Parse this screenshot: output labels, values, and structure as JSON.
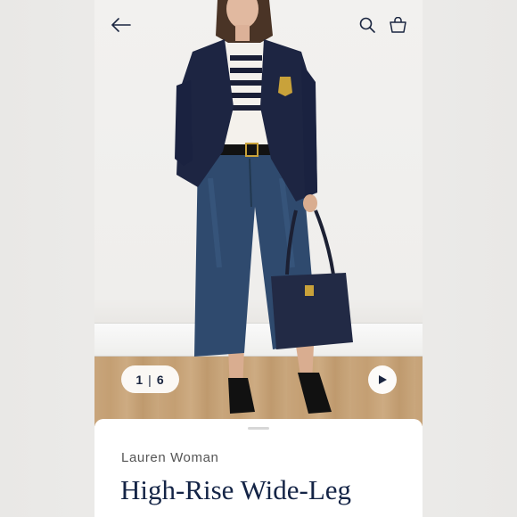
{
  "nav": {
    "back_icon": "arrow-left-icon",
    "search_icon": "search-icon",
    "bag_icon": "shopping-bag-icon"
  },
  "gallery": {
    "current": "1",
    "separator": "|",
    "total": "6",
    "play_icon": "play-icon"
  },
  "product": {
    "brand": "Lauren Woman",
    "title": "High-Rise Wide-Leg"
  },
  "colors": {
    "navy": "#142446",
    "denim": "#2f4a6e",
    "blazer": "#1d2542",
    "gold": "#c9a23a"
  }
}
